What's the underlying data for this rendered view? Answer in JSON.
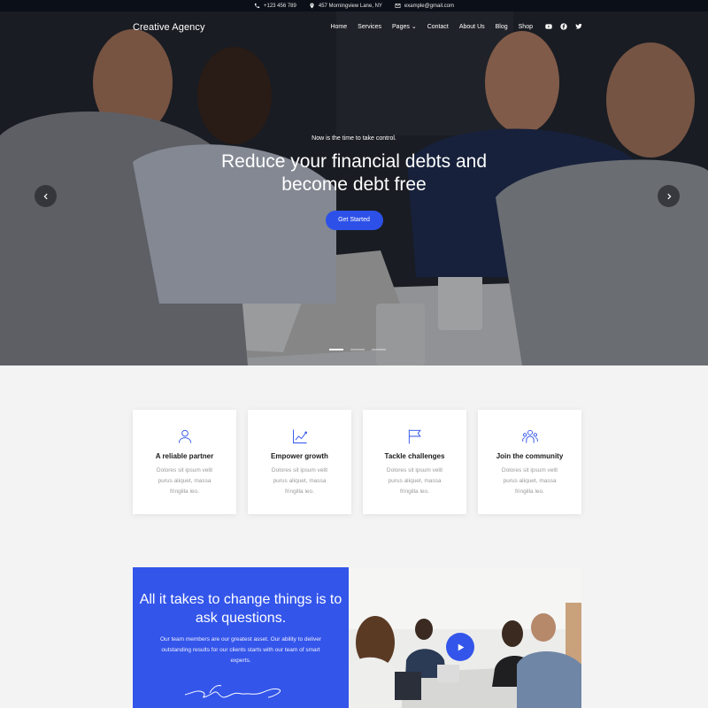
{
  "topbar": {
    "phone": "+123 456 789",
    "address": "457 Morningview Lane, NY",
    "email": "example@gmail.com"
  },
  "nav": {
    "brand": "Creative Agency",
    "items": [
      "Home",
      "Services",
      "Pages",
      "Contact",
      "About Us",
      "Blog",
      "Shop"
    ],
    "social": [
      "youtube-icon",
      "facebook-icon",
      "twitter-icon"
    ]
  },
  "hero": {
    "kicker": "Now is the time to take control.",
    "headline": "Reduce your financial debts and become debt free",
    "cta": "Get Started",
    "slides": 3,
    "active_slide": 1
  },
  "features": [
    {
      "icon": "user-icon",
      "title": "A reliable partner",
      "text": "Dolores sit ipsum velit purus aliquet, massa fringilla leo."
    },
    {
      "icon": "growth-chart-icon",
      "title": "Empower growth",
      "text": "Dolores sit ipsum velit purus aliquet, massa fringilla leo."
    },
    {
      "icon": "flag-icon",
      "title": "Tackle challenges",
      "text": "Dolores sit ipsum velit purus aliquet, massa fringilla leo."
    },
    {
      "icon": "community-icon",
      "title": "Join the community",
      "text": "Dolores sit ipsum velit purus aliquet, massa fringilla leo."
    }
  ],
  "about": {
    "heading": "All it takes to change things is to ask questions.",
    "text": "Our team members are our greatest asset. Our ability to deliver outstanding results for our clients starts with our team of smart experts.",
    "video_icon": "play-icon"
  },
  "colors": {
    "accent": "#3355ea",
    "topbar": "#0b0f17"
  }
}
